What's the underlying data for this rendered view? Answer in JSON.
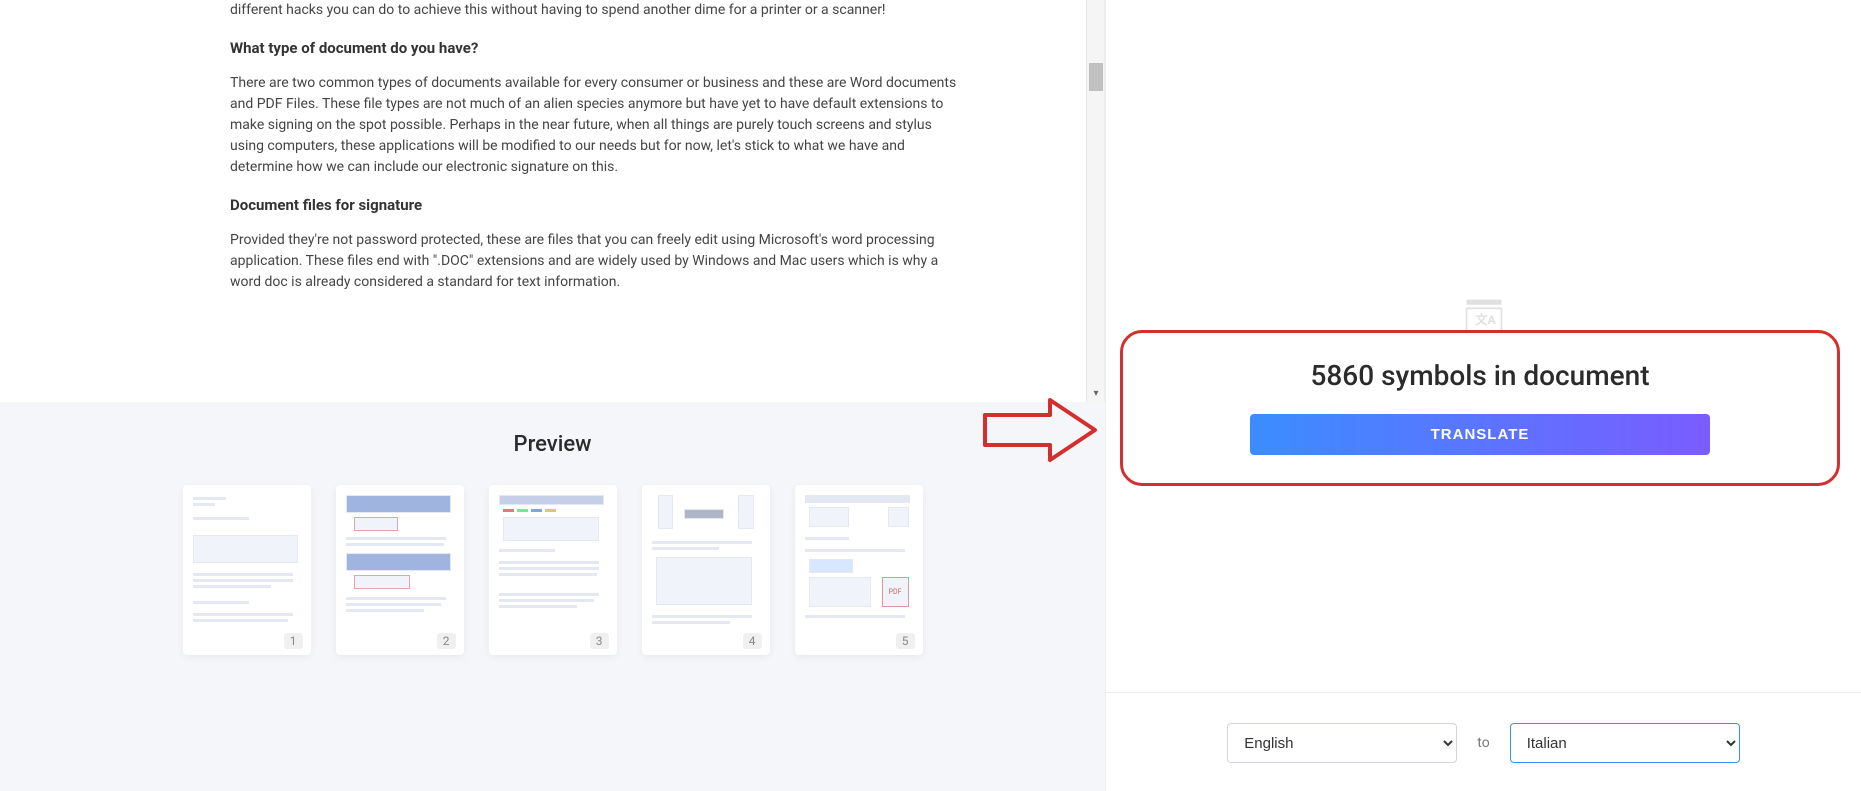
{
  "document": {
    "para_intro": "different hacks you can do to achieve this without having to spend another dime for a printer or a scanner!",
    "heading1": "What type of document do you have?",
    "para1": "There are two common types of documents available for every consumer or business and these are Word documents and PDF Files. These file types are not much of an alien species anymore but have yet to have default extensions to make signing on the spot possible. Perhaps in the near future, when all things are purely touch screens and stylus using computers, these applications will be modified to our needs but for now, let's stick to what we have and determine how we can include our electronic signature on this.",
    "heading2": "Document files for signature",
    "para2": "Provided they're not password protected, these are files that you can freely edit using Microsoft's word processing application. These files end with \".DOC\" extensions and are widely used by Windows and Mac users which is why a word doc is already considered a standard for text information."
  },
  "preview": {
    "title": "Preview",
    "pages": [
      "1",
      "2",
      "3",
      "4",
      "5"
    ]
  },
  "translate": {
    "symbols_text": "5860 symbols in document",
    "button_label": "TRANSLATE",
    "to_label": "to",
    "source_lang": "English",
    "target_lang": "Italian"
  }
}
